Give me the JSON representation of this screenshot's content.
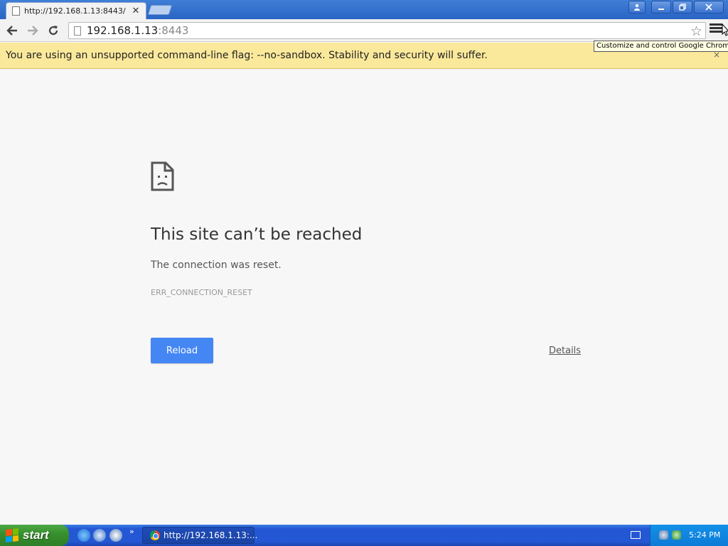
{
  "browser": {
    "tab_title": "http://192.168.1.13:8443/ ",
    "address_host": "192.168.1.13",
    "address_port": ":8443",
    "menu_tooltip": "Customize and control Google Chrome"
  },
  "infobar": {
    "message": "You are using an unsupported command-line flag: --no-sandbox. Stability and security will suffer.",
    "close_glyph": "×"
  },
  "error_page": {
    "headline": "This site can’t be reached",
    "description": "The connection was reset.",
    "error_code": "ERR_CONNECTION_RESET",
    "reload_label": "Reload",
    "details_label": "Details"
  },
  "taskbar": {
    "start_label": "start",
    "task_label": "http://192.168.1.13:...",
    "clock": "5:24 PM",
    "quicklaunch_more": "»"
  },
  "icons": {
    "back": "back-arrow-icon",
    "forward": "forward-arrow-icon",
    "reload": "reload-icon",
    "star": "star-icon",
    "menu": "hamburger-menu-icon",
    "sad_page": "sad-page-icon"
  },
  "colors": {
    "infobar_bg": "#fbe99b",
    "reload_button": "#4486f4",
    "taskbar": "#2457d3",
    "start_button": "#37912e"
  }
}
